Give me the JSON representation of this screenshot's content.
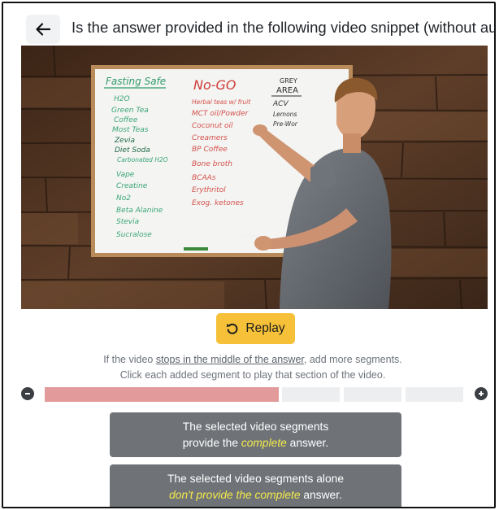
{
  "header": {
    "back_icon": "arrow-left-icon",
    "question": "Is the answer provided in the following video snippet (without audio)?"
  },
  "video": {
    "board": {
      "col1_title": "Fasting Safe",
      "col1_items": [
        "H2O",
        "Green Tea",
        "Coffee",
        "Most Teas",
        "Zevia",
        "Diet Soda",
        "Carbonated H2O",
        "Vape",
        "Creatine",
        "No2",
        "Beta Alanine",
        "Stevia",
        "Sucralose"
      ],
      "col2_title": "No-GO",
      "col2_items": [
        "Herbal teas w/ fruit",
        "MCT oil/Powder",
        "Coconut oil",
        "Creamers",
        "BP Coffee",
        "Bone broth",
        "BCAAs",
        "Erythritol",
        "Exog. ketones"
      ],
      "col3_title_1": "GREY",
      "col3_title_2": "AREA",
      "col3_items": [
        "ACV",
        "Lemons",
        "Pre-Wor"
      ]
    }
  },
  "replay": {
    "label": "Replay",
    "icon": "replay-icon"
  },
  "instructions": {
    "line1_before": "If the video ",
    "line1_link": "stops in the middle of the answer",
    "line1_after": ", add more segments.",
    "line2": "Click each added segment to play that section of the video."
  },
  "timeline": {
    "remove_icon": "minus-circle-icon",
    "add_icon": "plus-circle-icon",
    "selected_segments": 1,
    "total_segments": 4
  },
  "choices": {
    "complete": {
      "line1": "The selected video segments",
      "line2_before": "provide the ",
      "line2_hl": "complete",
      "line2_after": " answer."
    },
    "incomplete": {
      "line1": "The selected video segments alone",
      "line2_hl": "don't provide the complete",
      "line2_after": " answer."
    }
  },
  "colors": {
    "accent_yellow": "#f6c138",
    "segment_selected": "#e29b9a",
    "segment_unselected": "#eceef0",
    "choice_bg": "#6f7378",
    "highlight": "#f3ea4a"
  }
}
